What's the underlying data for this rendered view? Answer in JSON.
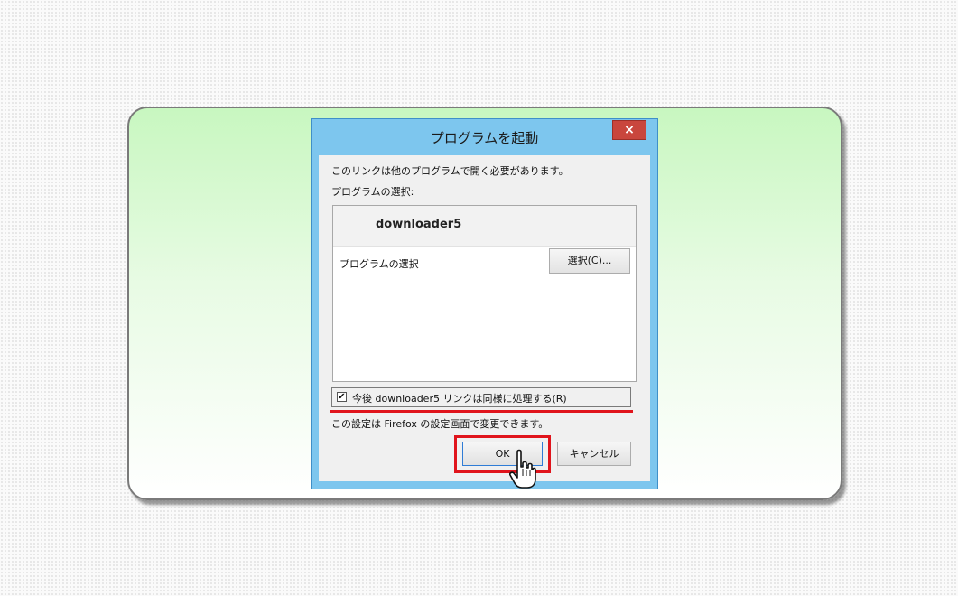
{
  "dialog": {
    "title": "プログラムを起動",
    "close_glyph": "×",
    "message": "このリンクは他のプログラムで開く必要があります。",
    "program_select_label": "プログラムの選択:",
    "list": {
      "top_item": "downloader5",
      "choose_label": "プログラムの選択",
      "choose_button": "選択(C)..."
    },
    "remember": {
      "checked": true,
      "check_glyph": "✔",
      "label": "今後 downloader5 リンクは同様に処理する(R)"
    },
    "note": "この設定は Firefox の設定画面で変更できます。",
    "ok_button": "OK",
    "cancel_button": "キャンセル"
  },
  "colors": {
    "highlight_red": "#e0141c",
    "title_bar": "#7dc6ee",
    "close_button": "#c9463d",
    "panel_green": "#c8f7c0"
  },
  "icons": {
    "cursor": "hand-pointer-icon",
    "close": "close-icon",
    "checkbox": "check-icon"
  }
}
